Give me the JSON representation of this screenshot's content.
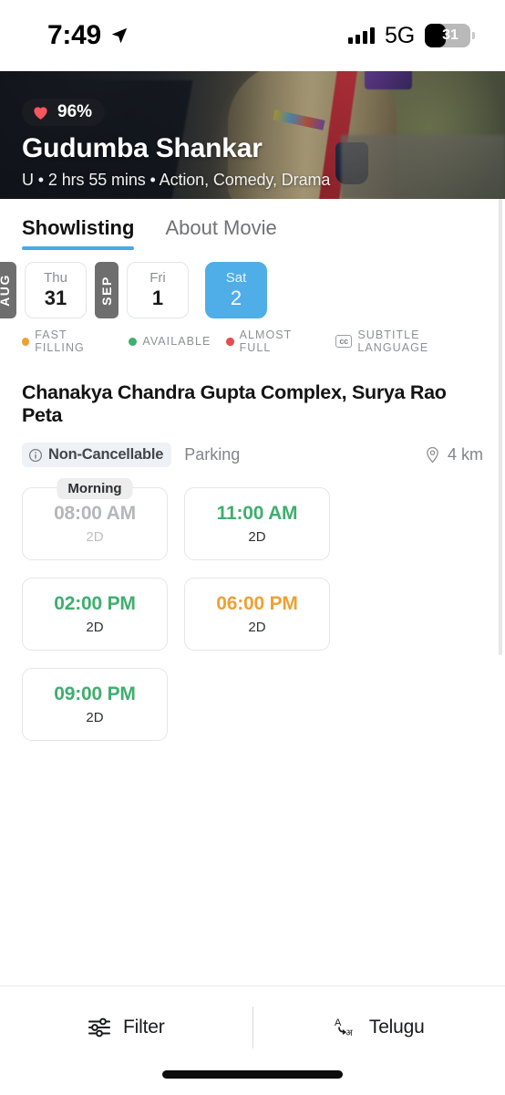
{
  "status_bar": {
    "time": "7:49",
    "location_icon": "location-arrow-icon",
    "signal_icon": "signal-bars-icon",
    "network": "5G",
    "battery_level": "31"
  },
  "hero": {
    "like_icon": "heart-icon",
    "like_percent": "96%",
    "title": "Gudumba Shankar",
    "meta": "U • 2 hrs 55 mins • Action, Comedy, Drama"
  },
  "tabs": [
    {
      "label": "Showlisting",
      "active": true
    },
    {
      "label": "About Movie",
      "active": false
    }
  ],
  "dates": {
    "month_labels": [
      "AUG",
      "SEP"
    ],
    "items": [
      {
        "dow": "Thu",
        "day": "31",
        "selected": false
      },
      {
        "dow": "Fri",
        "day": "1",
        "selected": false
      },
      {
        "dow": "Sat",
        "day": "2",
        "selected": true
      }
    ]
  },
  "legend": [
    {
      "label": "FAST FILLING",
      "color": "#EDA134",
      "icon": "dot-icon"
    },
    {
      "label": "AVAILABLE",
      "color": "#3FAE6E",
      "icon": "dot-icon"
    },
    {
      "label": "ALMOST FULL",
      "color": "#E84C4C",
      "icon": "dot-icon"
    },
    {
      "label": "SUBTITLE LANGUAGE",
      "color": "#9A9DA1",
      "icon": "cc-icon",
      "cc_text": "cc"
    }
  ],
  "theatre": {
    "name": "Chanakya Chandra Gupta Complex, Surya Rao Peta",
    "non_cancellable_label": "Non-Cancellable",
    "info_icon": "info-circle-icon",
    "parking_label": "Parking",
    "distance": "4 km",
    "distance_icon": "map-pin-icon"
  },
  "showtimes": {
    "period_label": "Morning",
    "items": [
      {
        "time": "08:00 AM",
        "format": "2D",
        "status": "disabled"
      },
      {
        "time": "11:00 AM",
        "format": "2D",
        "status": "available"
      },
      {
        "time": "02:00 PM",
        "format": "2D",
        "status": "available"
      },
      {
        "time": "06:00 PM",
        "format": "2D",
        "status": "fast"
      },
      {
        "time": "09:00 PM",
        "format": "2D",
        "status": "available"
      }
    ]
  },
  "bottom_bar": {
    "filter_label": "Filter",
    "filter_icon": "sliders-icon",
    "language_label": "Telugu",
    "language_icon": "translate-icon"
  },
  "colors": {
    "accent_blue": "#4FADE8",
    "available_green": "#3FAE6E",
    "fast_orange": "#EDA134",
    "full_red": "#E84C4C",
    "heart_pink": "#F8555F"
  }
}
